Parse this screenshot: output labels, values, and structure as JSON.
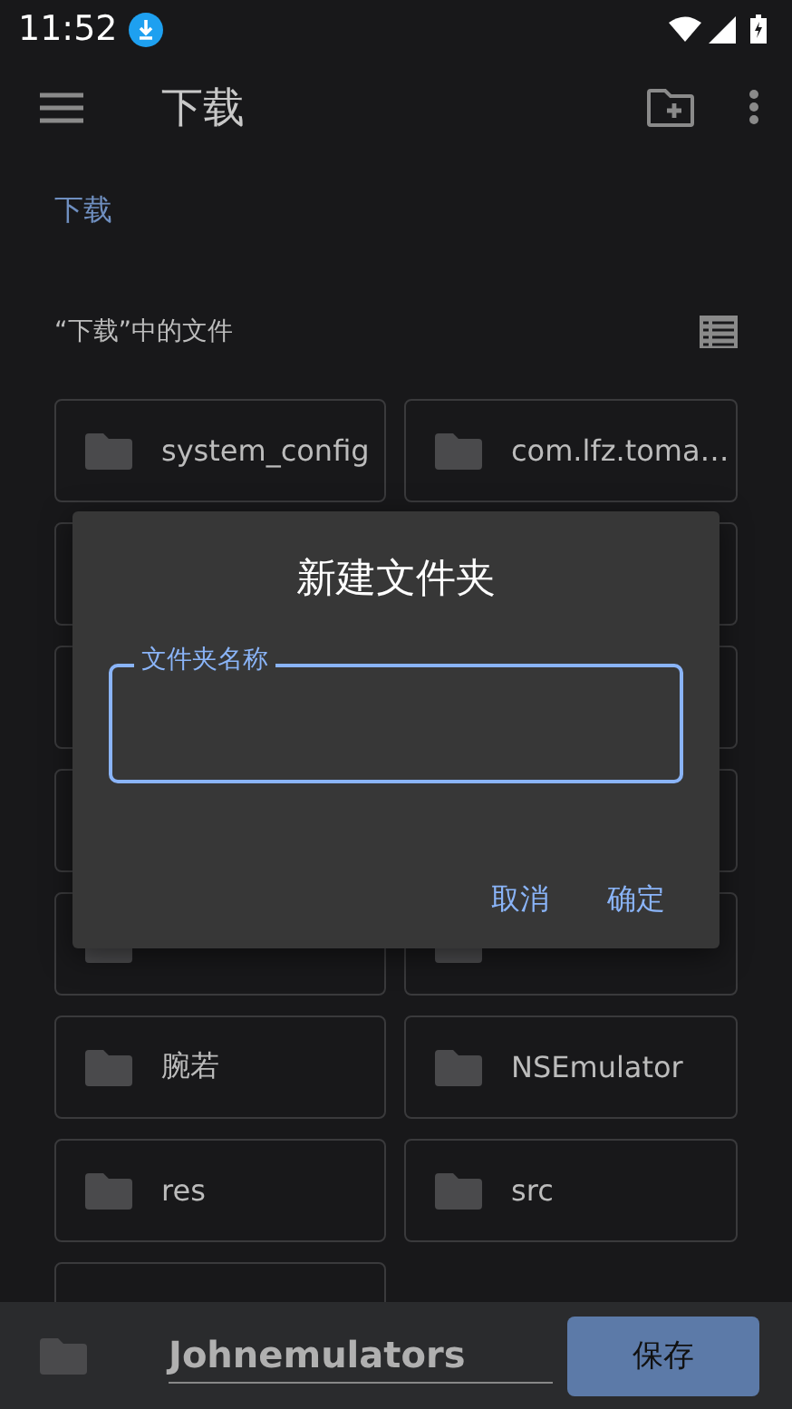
{
  "status_bar": {
    "time": "11:52"
  },
  "app_bar": {
    "title": "下载"
  },
  "breadcrumb": "下载",
  "section": {
    "title": "“下载”中的文件"
  },
  "items": [
    {
      "kind": "folder",
      "name": "system_config"
    },
    {
      "kind": "folder",
      "name": "com.lfz.toma…"
    },
    {
      "kind": "covered"
    },
    {
      "kind": "covered"
    },
    {
      "kind": "covered"
    },
    {
      "kind": "covered"
    },
    {
      "kind": "covered"
    },
    {
      "kind": "covered"
    },
    {
      "kind": "folder_unlabeled"
    },
    {
      "kind": "folder_unlabeled"
    },
    {
      "kind": "folder",
      "name": "腕若"
    },
    {
      "kind": "folder",
      "name": "NSEmulator"
    },
    {
      "kind": "folder",
      "name": "res"
    },
    {
      "kind": "folder",
      "name": "src"
    },
    {
      "kind": "covered"
    }
  ],
  "dialog": {
    "title": "新建文件夹",
    "field": {
      "label": "文件夹名称",
      "focused": true
    },
    "buttons": [
      "取消",
      "确定"
    ]
  },
  "save_bar": {
    "filename": "Johnemulators",
    "button": "保存"
  }
}
